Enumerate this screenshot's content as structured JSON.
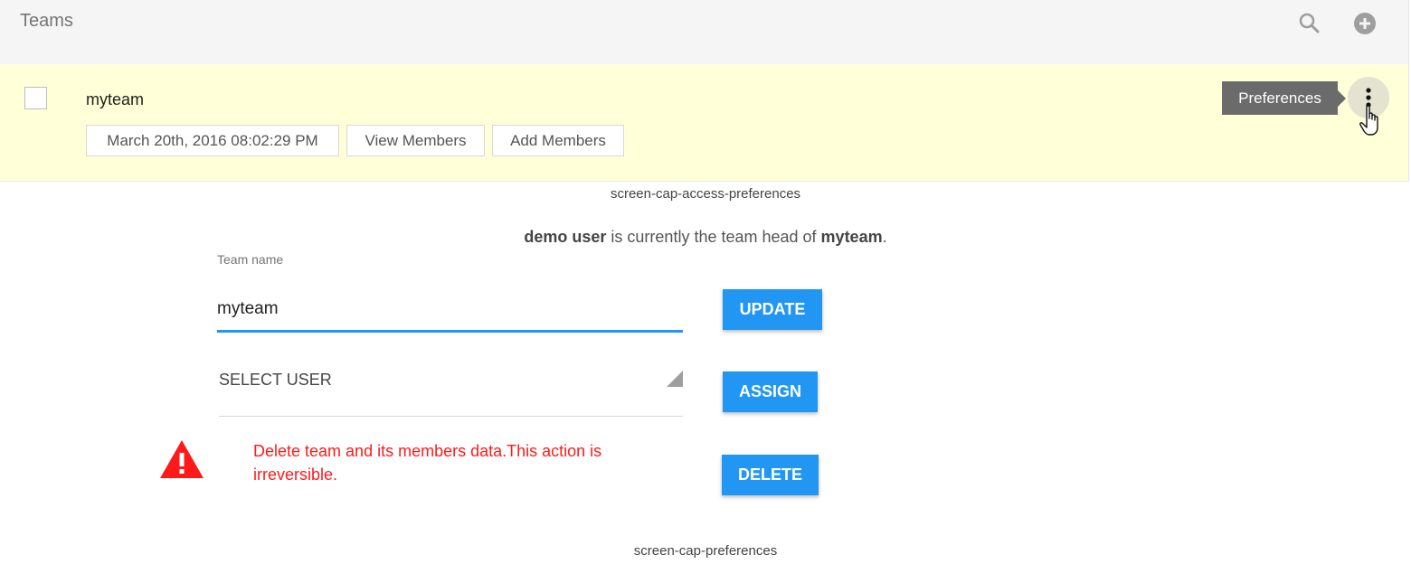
{
  "header": {
    "title": "Teams",
    "icons": [
      "search-icon",
      "add-circle-icon"
    ]
  },
  "team_row": {
    "name": "myteam",
    "created_at": "March 20th, 2016 08:02:29 PM",
    "view_members_label": "View Members",
    "add_members_label": "Add Members",
    "tooltip": "Preferences",
    "highlight_color": "#ffffd8"
  },
  "captions": {
    "first": "screen-cap-access-preferences",
    "second": "screen-cap-preferences"
  },
  "preferences": {
    "head_user": "demo user",
    "head_text": " is currently the team head of ",
    "head_team": "myteam",
    "head_suffix": ".",
    "team_name_label": "Team name",
    "team_name_value": "myteam",
    "update_label": "UPDATE",
    "select_user_value": "SELECT USER",
    "assign_label": "ASSIGN",
    "delete_warning": "Delete team and its members data.This action is irreversible.",
    "delete_label": "DELETE",
    "accent_color": "#2196f3",
    "danger_color": "#ff1a1a"
  }
}
